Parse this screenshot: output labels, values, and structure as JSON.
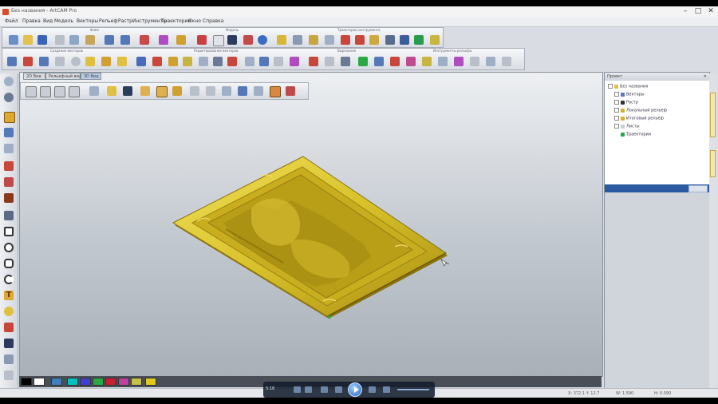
{
  "window": {
    "title": "Без названия - ArtCAM Pro",
    "controls": [
      "–",
      "□",
      "✕"
    ]
  },
  "menu": [
    "Файл",
    "Правка",
    "Вид",
    "Модель",
    "Векторы",
    "Рельеф",
    "Растр",
    "Инструменты",
    "Траектории",
    "Окно",
    "Справка"
  ],
  "toolbar_captions": {
    "row1_a": "Файл",
    "row1_b": "Модель",
    "row1_c": "Траектории инструмента",
    "row2_a": "Создание векторов",
    "row2_b": "Редактирование векторов",
    "row2_c": "Вырезание",
    "row2_d": "Инструменты рельефа"
  },
  "viewport": {
    "tabs": [
      "2D Вид",
      "Рельефный вид",
      "3D Вид"
    ],
    "active_tab": 2
  },
  "project_panel": {
    "title": "Проект",
    "close": "✕",
    "tree": [
      {
        "label": "Без названия",
        "level": 0,
        "icon": "folder-icon"
      },
      {
        "label": "Векторы",
        "level": 1,
        "icon": "vector-icon"
      },
      {
        "label": "Растр",
        "level": 1,
        "icon": "raster-icon"
      },
      {
        "label": "Локальный рельеф",
        "level": 1,
        "icon": "relief-icon"
      },
      {
        "label": "Итоговый рельеф",
        "level": 1,
        "icon": "relief-icon"
      },
      {
        "label": "Листы",
        "level": 1,
        "icon": "sheet-icon"
      },
      {
        "label": "Траектории",
        "level": 1,
        "icon": "toolpath-icon"
      }
    ]
  },
  "status": {
    "left": "",
    "coords": "X: 372.1 Y: 12.7",
    "size": "W: 1.590",
    "right": "H: 0.090"
  },
  "player": {
    "time": "5:18"
  },
  "colors": {
    "relief_gold": "#d8c22a",
    "viewport_top": "#edeff2",
    "viewport_bottom": "#a9b0b8",
    "panel_blue": "#2b5aa0",
    "palette": [
      "#000000",
      "#ffffff",
      "#3f7fbf",
      "#00c0c0",
      "#4040d0",
      "#2aa845",
      "#c82030",
      "#c040a0",
      "#c8c048",
      "#e0c820"
    ]
  }
}
